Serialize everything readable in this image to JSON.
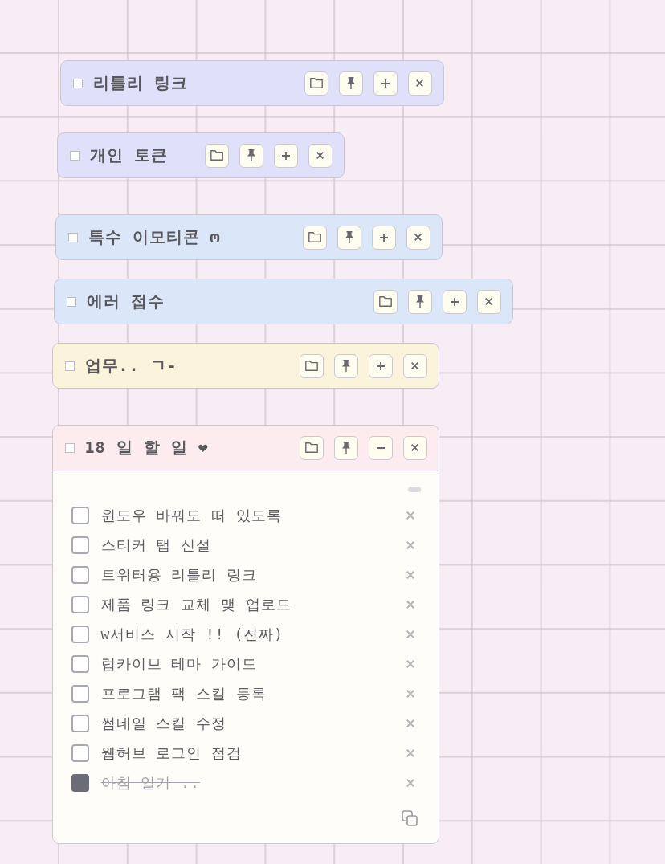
{
  "stickies": [
    {
      "title": "리틀리 링크",
      "checked": false,
      "expanded": false,
      "color": "#e0e0fb"
    },
    {
      "title": "개인 토큰",
      "checked": false,
      "expanded": false,
      "color": "#e0e0fb"
    },
    {
      "title": "특수 이모티콘 ო",
      "checked": false,
      "expanded": false,
      "color": "#dbe6f8"
    },
    {
      "title": "에러 접수",
      "checked": false,
      "expanded": false,
      "color": "#dbe6f8"
    },
    {
      "title": "업무.. ㄱ-",
      "checked": false,
      "expanded": false,
      "color": "#fcf3dd"
    },
    {
      "title": "18 일 할 일 ❤",
      "checked": false,
      "expanded": true,
      "color": "#fcecf0",
      "todos": [
        {
          "text": "윈도우 바꿔도 떠 있도록",
          "checked": false
        },
        {
          "text": "스티커 탭 신설",
          "checked": false
        },
        {
          "text": "트위터용 리틀리 링크",
          "checked": false
        },
        {
          "text": "제품 링크 교체 맺 업로드",
          "checked": false
        },
        {
          "text": "w서비스 시작 !! (진짜)",
          "checked": false
        },
        {
          "text": "럽카이브 테마 가이드",
          "checked": false
        },
        {
          "text": "프로그램 팩 스킬 등록",
          "checked": false
        },
        {
          "text": "썸네일 스킬 수정",
          "checked": false
        },
        {
          "text": "웹허브 로그인 점검",
          "checked": false
        },
        {
          "text": "아침 일기 ..",
          "checked": true
        }
      ]
    }
  ]
}
